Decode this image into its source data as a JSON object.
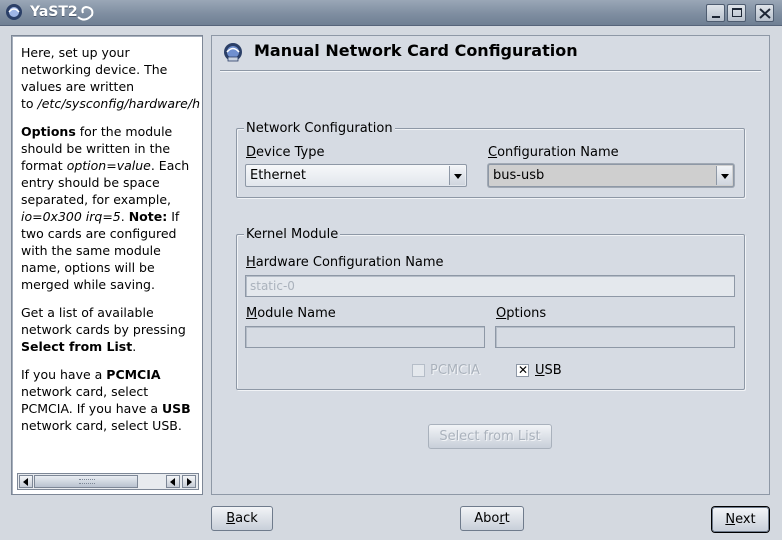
{
  "window": {
    "title": "YaST2",
    "controls": [
      "minimize-icon",
      "maximize-icon",
      "close-icon"
    ]
  },
  "help": {
    "p1_line1": "Here, set up your",
    "p1_line2": "networking device. The",
    "p1_line3": "values are written",
    "p1_line4_prefix": "to ",
    "p1_path": "/etc/sysconfig/hardware/h",
    "p2_bold_options": "Options",
    "p2_t1": " for the module should be written in the format ",
    "p2_italic_format": "option=value",
    "p2_t2": ". Each entry should be space separated, for example, ",
    "p2_italic_example": "io=0x300 irq=5",
    "p2_t3": ". ",
    "p2_bold_note": "Note:",
    "p2_t4": " If two cards are configured with the same module name, options will be merged while saving.",
    "p3_t1": "Get a list of available network cards by pressing ",
    "p3_bold": "Select from List",
    "p3_t2": ".",
    "p4_t1": "If you have a ",
    "p4_bold1": "PCMCIA",
    "p4_t2": " network card, select PCMCIA. If you have a ",
    "p4_bold2": "USB",
    "p4_t3": " network card, select USB."
  },
  "main": {
    "title": "Manual Network Card Configuration",
    "network_group": {
      "title": "Network Configuration",
      "device_type_label_u": "D",
      "device_type_label_rest": "evice Type",
      "device_type_value": "Ethernet",
      "config_name_label_u": "C",
      "config_name_label_rest": "onfiguration Name",
      "config_name_value": "bus-usb"
    },
    "kernel_group": {
      "title": "Kernel Module",
      "hw_config_label_u": "H",
      "hw_config_label_rest": "ardware Configuration Name",
      "hw_config_value": "static-0",
      "module_name_label_u": "M",
      "module_name_label_rest": "odule Name",
      "module_name_value": "",
      "options_label_u": "O",
      "options_label_rest": "ptions",
      "options_value": "",
      "pcmcia_label": "PCMCIA",
      "pcmcia_checked": false,
      "usb_label_u": "U",
      "usb_label_rest": "SB",
      "usb_checked": true,
      "usb_mark": "✕"
    },
    "select_from_list_label": "Select from List"
  },
  "footer": {
    "back_u": "B",
    "back_rest": "ack",
    "abort_pre": "Abo",
    "abort_u": "r",
    "abort_post": "t",
    "next_u": "N",
    "next_rest": "ext"
  }
}
